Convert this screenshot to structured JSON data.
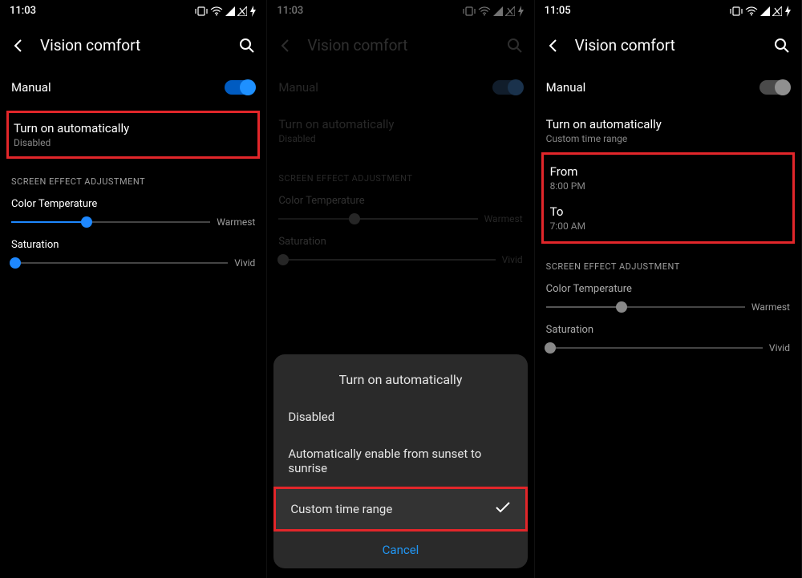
{
  "panel1": {
    "time": "11:03",
    "title": "Vision comfort",
    "manual_label": "Manual",
    "auto_label": "Turn on automatically",
    "auto_value": "Disabled",
    "section_header": "SCREEN EFFECT ADJUSTMENT",
    "color_temp_label": "Color Temperature",
    "color_temp_end": "Warmest",
    "saturation_label": "Saturation",
    "saturation_end": "Vivid",
    "color_temp_pct": 38,
    "saturation_pct": 2
  },
  "panel2": {
    "time": "11:03",
    "title": "Vision comfort",
    "manual_label": "Manual",
    "auto_label": "Turn on automatically",
    "auto_value": "Disabled",
    "section_header": "SCREEN EFFECT ADJUSTMENT",
    "color_temp_label": "Color Temperature",
    "color_temp_end": "Warmest",
    "saturation_label": "Saturation",
    "saturation_end": "Vivid",
    "color_temp_pct": 38,
    "saturation_pct": 2,
    "dialog_title": "Turn on automatically",
    "opt1": "Disabled",
    "opt2": "Automatically enable from sunset to sunrise",
    "opt3": "Custom time range",
    "cancel": "Cancel"
  },
  "panel3": {
    "time": "11:05",
    "title": "Vision comfort",
    "manual_label": "Manual",
    "auto_label": "Turn on automatically",
    "auto_value": "Custom time range",
    "from_label": "From",
    "from_value": "8:00 PM",
    "to_label": "To",
    "to_value": "7:00 AM",
    "section_header": "SCREEN EFFECT ADJUSTMENT",
    "color_temp_label": "Color Temperature",
    "color_temp_end": "Warmest",
    "saturation_label": "Saturation",
    "saturation_end": "Vivid",
    "color_temp_pct": 38,
    "saturation_pct": 2
  }
}
